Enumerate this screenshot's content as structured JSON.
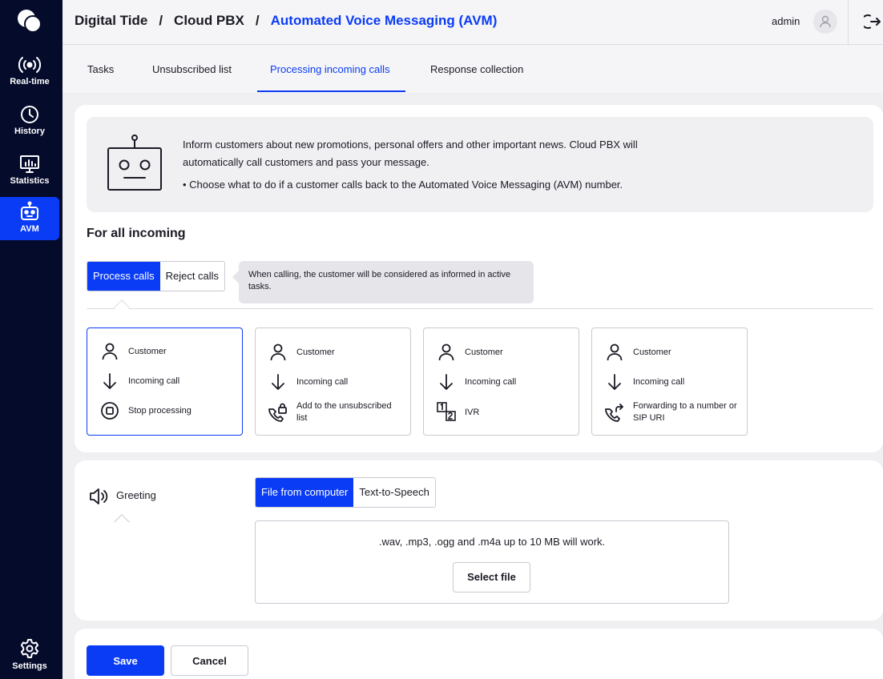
{
  "sidebar": {
    "items": [
      {
        "label": "Real-time",
        "icon": "realtime-icon"
      },
      {
        "label": "History",
        "icon": "clock-icon"
      },
      {
        "label": "Statistics",
        "icon": "statistics-icon"
      },
      {
        "label": "AVM",
        "icon": "robot-icon"
      },
      {
        "label": "Settings",
        "icon": "gear-icon"
      }
    ],
    "active": "AVM"
  },
  "header": {
    "breadcrumb": [
      "Digital Tide",
      "Cloud PBX",
      "Automated Voice Messaging (AVM)"
    ],
    "separator": "/",
    "user": "admin"
  },
  "tabs": [
    {
      "label": "Tasks"
    },
    {
      "label": "Unsubscribed list"
    },
    {
      "label": "Processing incoming calls"
    },
    {
      "label": "Response collection"
    }
  ],
  "active_tab": "Processing incoming calls",
  "info": {
    "text": "Inform customers about new promotions, personal offers and other important news. Cloud PBX will automatically call customers and pass your message.",
    "bullet": "• Choose what to do if a customer calls back to the Automated Voice Messaging (AVM) number."
  },
  "incoming": {
    "title": "For all incoming",
    "toggle": {
      "options": [
        "Process calls",
        "Reject calls"
      ],
      "selected": "Process calls"
    },
    "tooltip": "When calling, the customer will be considered as informed in active tasks.",
    "flows": [
      {
        "customer": "Customer",
        "incoming": "Incoming call",
        "action": "Stop processing",
        "icon": "stop-icon",
        "selected": true
      },
      {
        "customer": "Customer",
        "incoming": "Incoming call",
        "action": "Add to the unsubscribed list",
        "icon": "phone-lock-icon",
        "selected": false
      },
      {
        "customer": "Customer",
        "incoming": "Incoming call",
        "action": "IVR",
        "icon": "ivr-icon",
        "selected": false
      },
      {
        "customer": "Customer",
        "incoming": "Incoming call",
        "action": "Forwarding to a number or SIP URI",
        "icon": "phone-forward-icon",
        "selected": false
      }
    ]
  },
  "greeting": {
    "label": "Greeting",
    "toggle": {
      "options": [
        "File from computer",
        "Text-to-Speech"
      ],
      "selected": "File from computer"
    },
    "note": ".wav, .mp3, .ogg and .m4a up to 10 MB will work.",
    "select_label": "Select file"
  },
  "footer": {
    "save": "Save",
    "cancel": "Cancel"
  },
  "colors": {
    "accent": "#0a3cf5",
    "sidebar": "#050b2b"
  }
}
